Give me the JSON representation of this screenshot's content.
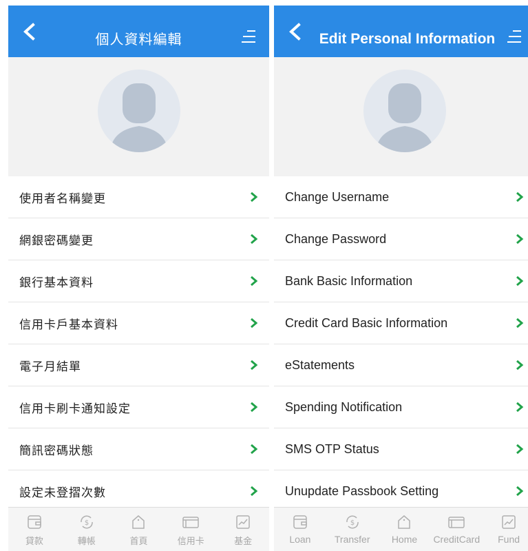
{
  "colors": {
    "header": "#2b8ae5",
    "chevron": "#21a34a",
    "tab_inactive": "#a7a7a7"
  },
  "panels": [
    {
      "title": "個人資料編輯",
      "items": [
        {
          "label": "使用者名稱變更"
        },
        {
          "label": "網銀密碼變更"
        },
        {
          "label": "銀行基本資料"
        },
        {
          "label": "信用卡戶基本資料"
        },
        {
          "label": "電子月結單"
        },
        {
          "label": "信用卡刷卡通知設定"
        },
        {
          "label": "簡訊密碼狀態"
        },
        {
          "label": "設定未登摺次數"
        }
      ],
      "tabs": [
        {
          "label": "貸款",
          "icon": "wallet-icon"
        },
        {
          "label": "轉帳",
          "icon": "transfer-icon"
        },
        {
          "label": "首頁",
          "icon": "home-icon"
        },
        {
          "label": "信用卡",
          "icon": "credit-card-icon"
        },
        {
          "label": "基金",
          "icon": "fund-icon"
        }
      ]
    },
    {
      "title": "Edit Personal Information",
      "items": [
        {
          "label": "Change Username"
        },
        {
          "label": "Change Password"
        },
        {
          "label": "Bank Basic Information"
        },
        {
          "label": "Credit Card Basic Information"
        },
        {
          "label": "eStatements"
        },
        {
          "label": "Spending Notification"
        },
        {
          "label": "SMS OTP Status"
        },
        {
          "label": "Unupdate Passbook Setting"
        }
      ],
      "tabs": [
        {
          "label": "Loan",
          "icon": "wallet-icon"
        },
        {
          "label": "Transfer",
          "icon": "transfer-icon"
        },
        {
          "label": "Home",
          "icon": "home-icon"
        },
        {
          "label": "CreditCard",
          "icon": "credit-card-icon"
        },
        {
          "label": "Fund",
          "icon": "fund-icon"
        }
      ]
    }
  ]
}
